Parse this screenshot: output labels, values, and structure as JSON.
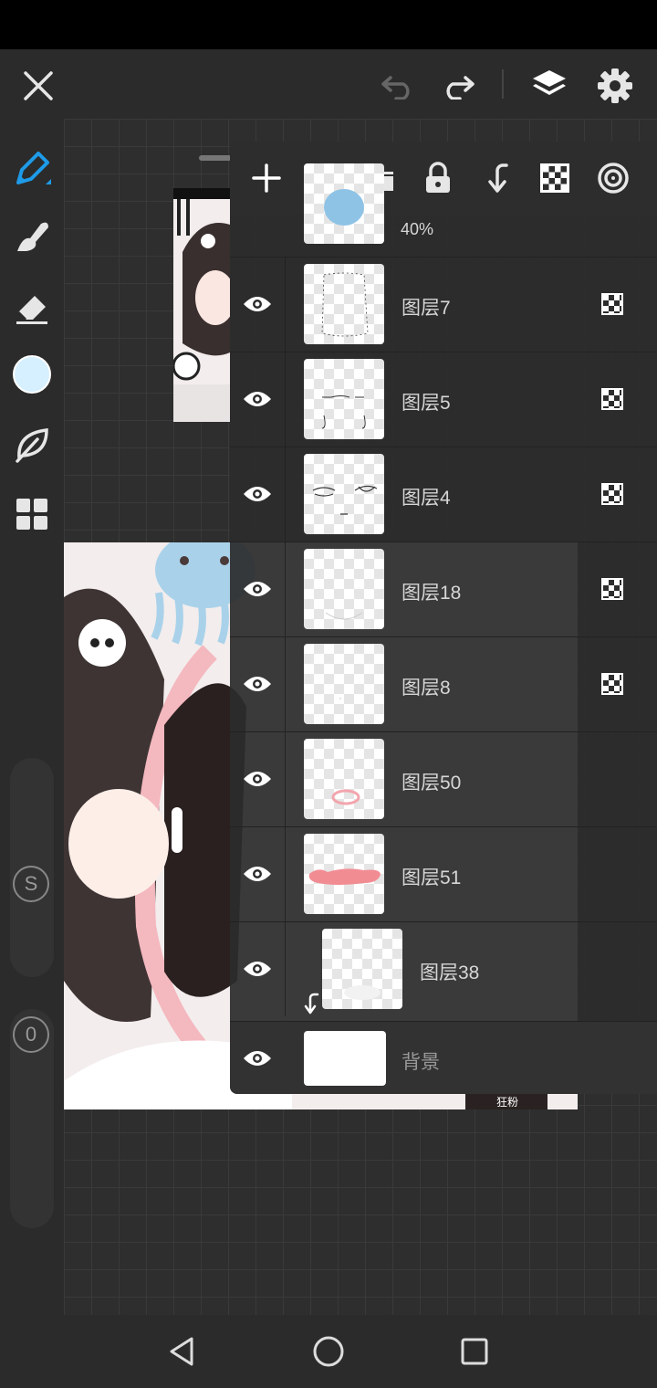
{
  "topbar": {
    "close_icon": "close-icon",
    "undo_icon": "undo-icon",
    "redo_icon": "redo-icon",
    "layers_icon": "layers-icon",
    "settings_icon": "gear-icon"
  },
  "toolbar": {
    "tools": [
      "pen-icon",
      "smudge-icon",
      "eraser-icon",
      "color-swatch",
      "leaf-icon",
      "grid-icon"
    ],
    "color": "#d6f0ff",
    "size_label": "S",
    "opacity_label": "0"
  },
  "layer_panel": {
    "toolbar_icons": [
      "add-icon",
      "folder-icon",
      "lock-icon",
      "merge-down-icon",
      "alpha-lock-icon",
      "blend-icon"
    ],
    "partial_layer": {
      "opacity": "40%"
    },
    "layers": [
      {
        "name": "图层7",
        "alpha_locked": true
      },
      {
        "name": "图层5",
        "alpha_locked": true
      },
      {
        "name": "图层4",
        "alpha_locked": true
      },
      {
        "name": "图层18",
        "alpha_locked": true
      },
      {
        "name": "图层8",
        "alpha_locked": true
      },
      {
        "name": "图层50",
        "alpha_locked": false
      },
      {
        "name": "图层51",
        "alpha_locked": false
      },
      {
        "name": "图层38",
        "alpha_locked": false,
        "clipped": true
      }
    ],
    "background_layer": {
      "name": "背景"
    }
  },
  "colors": {
    "accent": "#1e9be8",
    "panel": "#2c2c2c"
  },
  "artwork": {
    "badge_text": "狂粉"
  }
}
